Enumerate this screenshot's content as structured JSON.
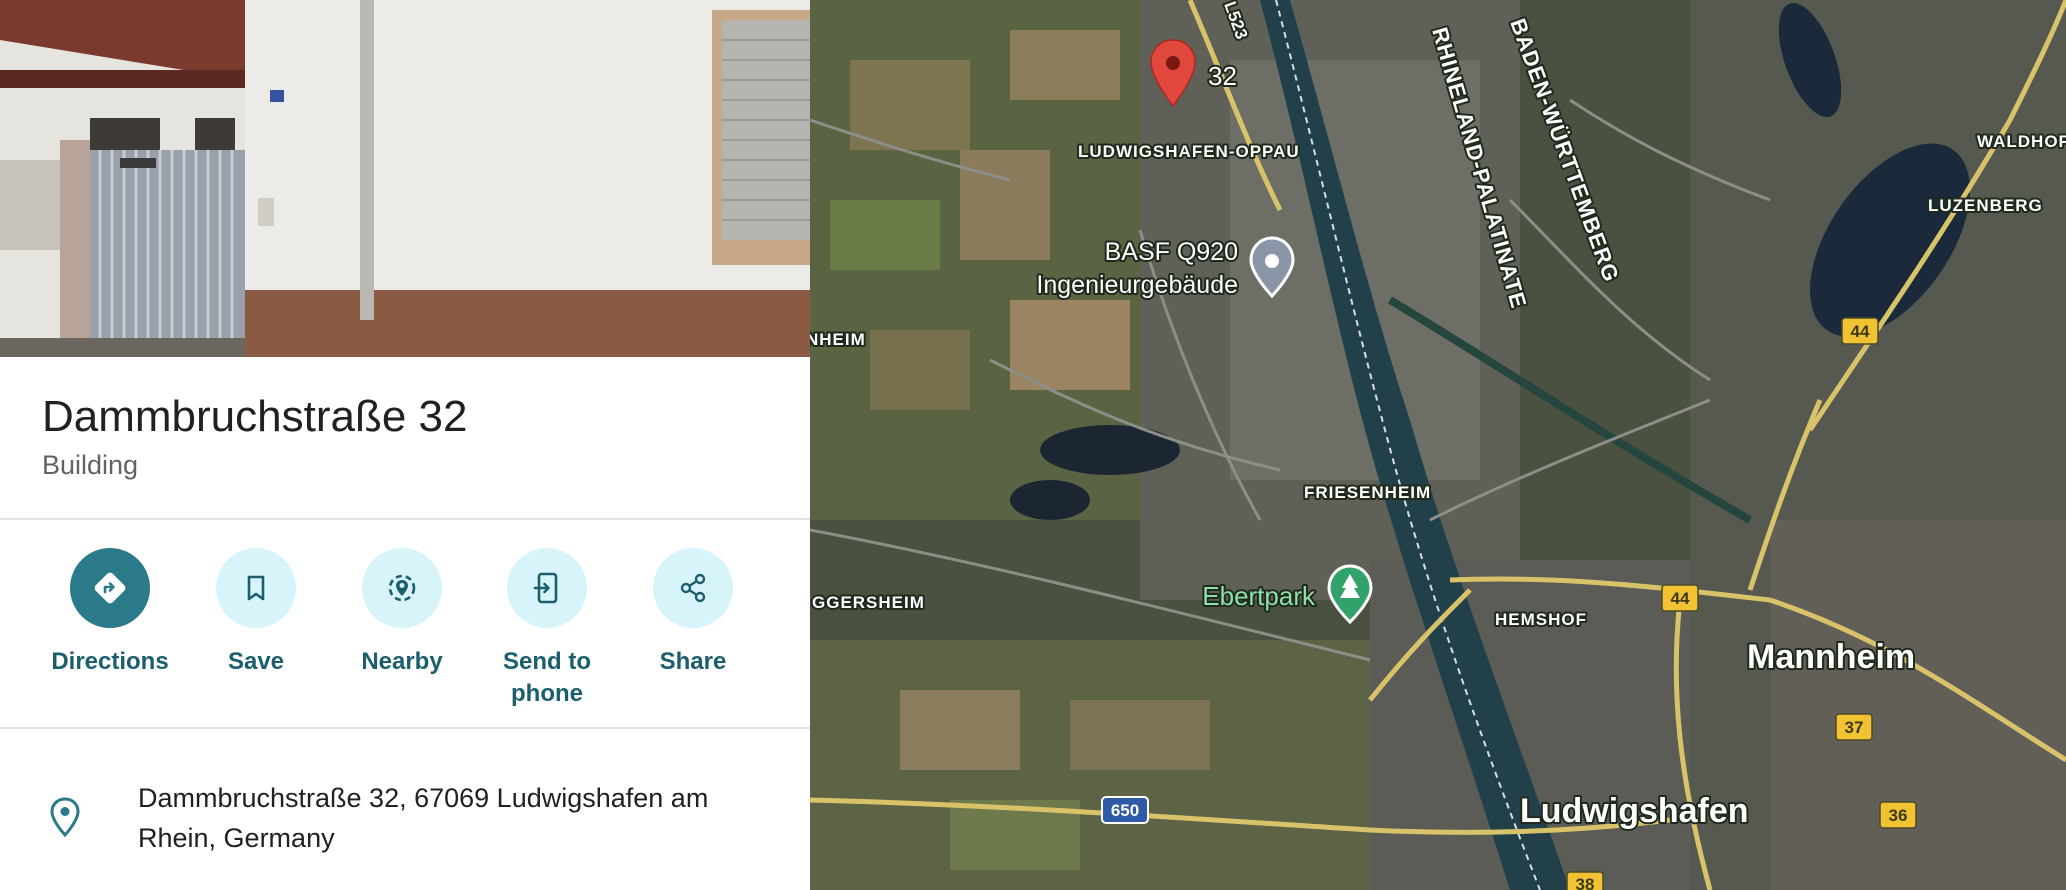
{
  "place": {
    "title": "Dammbruchstraße 32",
    "category": "Building"
  },
  "actions": [
    {
      "label": "Directions",
      "icon": "directions-icon"
    },
    {
      "label": "Save",
      "icon": "bookmark-icon"
    },
    {
      "label": "Nearby",
      "icon": "nearby-icon"
    },
    {
      "label": "Send to phone",
      "icon": "send-to-phone-icon"
    },
    {
      "label": "Share",
      "icon": "share-icon"
    }
  ],
  "address": "Dammbruchstraße 32, 67069 Ludwigshafen am Rhein, Germany",
  "colors": {
    "accent": "#2b7a8a",
    "action_bg": "#d7f4fb",
    "pin_red": "#e0473d",
    "road_yellow": "#d9c36a",
    "river": "#22404a"
  },
  "map": {
    "marker_label": "32",
    "places": {
      "oppau": "LUDWIGSHAFEN-OPPAU",
      "basf_line1": "BASF Q920",
      "basf_line2": "Ingenieurgebäude",
      "heim": "NHEIM",
      "friesenheim": "FRIESENHEIM",
      "ebertpark": "Ebertpark",
      "oggersheim": "GGERSHEIM",
      "hemshof": "HEMSHOF",
      "mannheim": "Mannheim",
      "ludwigshafen": "Ludwigshafen",
      "luzenberg": "LUZENBERG",
      "waldhof": "WALDHOF",
      "rhineland": "RHINELAND-PALATINATE",
      "baden": "BADEN-WÜRTTEMBERG"
    },
    "road_shields": {
      "l523": "L523",
      "a650": "650",
      "r44_top": "44",
      "r44_mid": "44",
      "r37": "37",
      "r36": "36",
      "r38": "38"
    }
  }
}
